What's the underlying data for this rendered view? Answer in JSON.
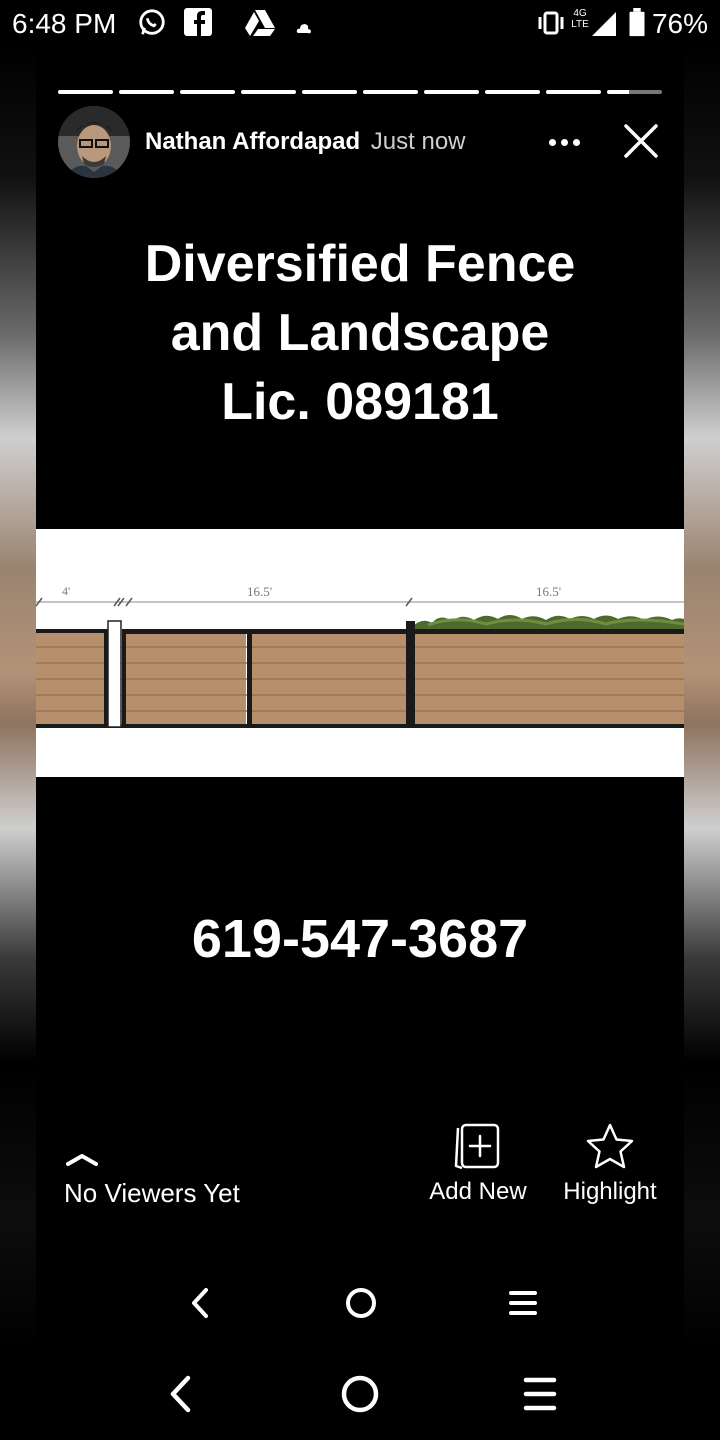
{
  "status_bar": {
    "time": "6:48 PM",
    "network_label": "4G LTE",
    "battery_percent": "76%",
    "notification_icons": [
      "whatsapp-icon",
      "facebook-icon",
      "drive-icon",
      "cloud-icon"
    ]
  },
  "story": {
    "author_name": "Nathan Affordapad",
    "post_time": "Just now",
    "progress_segments": 10,
    "headline_lines": [
      "Diversified Fence",
      "and Landscape",
      "Lic. 089181"
    ],
    "drawing": {
      "dimension_labels": [
        "4'",
        "16.5'",
        "16.5'"
      ]
    },
    "phone": "619-547-3687"
  },
  "bottom_bar": {
    "viewers_label": "No Viewers Yet",
    "add_new_label": "Add New",
    "highlight_label": "Highlight"
  },
  "colors": {
    "background": "#000000",
    "fence_wood": "#b68f6c",
    "fence_frame": "#1a1a1a",
    "foliage": "#4d6b2f"
  }
}
